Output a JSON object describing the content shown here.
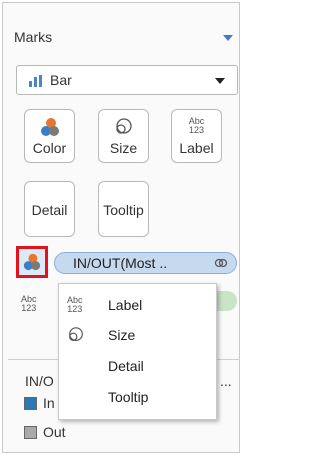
{
  "marks": {
    "title": "Marks",
    "mark_type": {
      "label": "Bar",
      "icon": "bar-chart-icon"
    },
    "buttons": [
      {
        "label": "Color",
        "icon": "color-circles-icon"
      },
      {
        "label": "Size",
        "icon": "size-circles-icon"
      },
      {
        "label": "Label",
        "icon": "abc-123-icon",
        "icon_text": [
          "Abc",
          "123"
        ]
      },
      {
        "label": "Detail"
      },
      {
        "label": "Tooltip"
      }
    ],
    "pill": {
      "label": "IN/OUT(Most ..",
      "icon": "link-icon"
    }
  },
  "row_icon": {
    "icon": "abc-123-icon",
    "icon_text": [
      "Abc",
      "123"
    ]
  },
  "context_menu": {
    "items": [
      {
        "label": "Label",
        "icon": "abc-123-icon",
        "icon_text": [
          "Abc",
          "123"
        ]
      },
      {
        "label": "Size",
        "icon": "size-circles-icon"
      },
      {
        "label": "Detail",
        "icon": ""
      },
      {
        "label": "Tooltip",
        "icon": ""
      }
    ]
  },
  "legend": {
    "title": "IN/O",
    "more": "...",
    "items": [
      {
        "label": "In",
        "color": "#2a7ab9"
      },
      {
        "label": "Out",
        "color": "#a9a9a9"
      }
    ]
  },
  "colors": {
    "accent": "#3b7ec8",
    "highlight_border": "#e0141e",
    "pill_fill": "#c6d9ee",
    "in_color": "#2a7ab9",
    "out_color": "#a9a9a9"
  }
}
